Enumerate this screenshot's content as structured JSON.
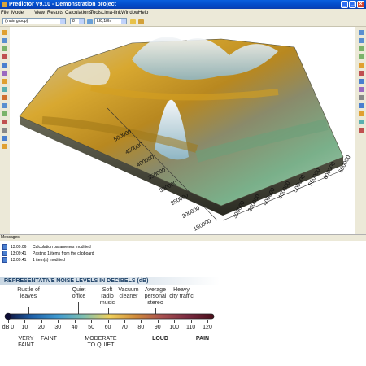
{
  "window": {
    "title": "Predictor V9.10 - Demonstration project"
  },
  "menu": [
    "File",
    "Model",
    "View",
    "Results",
    "Calculations",
    "Tools",
    "Lima-link",
    "Window",
    "Help"
  ],
  "toolbar": {
    "group_select": "(main group)",
    "small_select": "8",
    "layer_select": "LI0;18hr"
  },
  "plot3d": {
    "y_axis_ticks": [
      "150000",
      "200000",
      "250000",
      "300000",
      "350000",
      "400000",
      "450000",
      "500000"
    ],
    "x_axis_ticks": [
      "300000",
      "350000",
      "400000",
      "450000",
      "500000",
      "550000",
      "600000",
      "650000"
    ]
  },
  "messages": {
    "header": "Messages",
    "rows": [
      {
        "time": "13:09:06",
        "text": "Calculation parameters modified"
      },
      {
        "time": "13:09:41",
        "text": "Pasting 1 items from the clipboard"
      },
      {
        "time": "13:09:41",
        "text": "1 item(s) modified"
      }
    ]
  },
  "noise_scale": {
    "title": "REPRESENTATIVE NOISE LEVELS IN DECIBELS (dB)",
    "sources": [
      {
        "label": "Rustle of leaves",
        "db": 10
      },
      {
        "label": "Quiet office",
        "db": 40
      },
      {
        "label": "Soft radio music",
        "db": 60
      },
      {
        "label": "Vacuum cleaner",
        "db": 70
      },
      {
        "label": "Average personal stereo",
        "db": 90
      },
      {
        "label": "Heavy city traffic",
        "db": 100
      }
    ],
    "levels": [
      "dB 0",
      "10",
      "20",
      "30",
      "40",
      "50",
      "60",
      "70",
      "80",
      "90",
      "100",
      "110",
      "120"
    ],
    "categories": [
      {
        "label": "VERY FAINT",
        "bold": false
      },
      {
        "label": "FAINT",
        "bold": false
      },
      {
        "label": "MODERATE TO QUIET",
        "bold": false
      },
      {
        "label": "LOUD",
        "bold": true
      },
      {
        "label": "PAIN",
        "bold": true
      }
    ],
    "gradient_colors": [
      "#0d0d35",
      "#1d5fa8",
      "#3f9ad0",
      "#7fc0b0",
      "#f0d05a",
      "#d08a3a",
      "#a85050",
      "#7a2a40",
      "#4a0f1a"
    ]
  }
}
